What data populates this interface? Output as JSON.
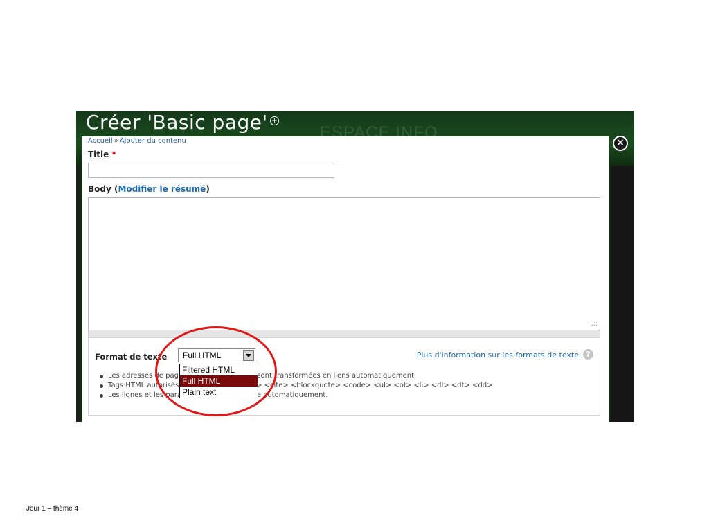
{
  "window": {
    "title": "Créer 'Basic page'",
    "background_brand": "ESPACE INFO"
  },
  "breadcrumb": {
    "home": "Accueil",
    "separator": "»",
    "current": "Ajouter du contenu"
  },
  "form": {
    "title_label": "Title",
    "required_marker": "*",
    "title_value": "",
    "body_label": "Body",
    "body_link": "Modifier le résumé",
    "body_value": ""
  },
  "text_format": {
    "label": "Format de texte",
    "selected": "Full HTML",
    "options": [
      "Filtered HTML",
      "Full HTML",
      "Plain text"
    ],
    "info_link": "Plus d'information sur les formats de texte",
    "tips": [
      "Les adresses de pages web et de courriels sont transformées en liens automatiquement.",
      "Tags HTML autorisés : <a> <em> <strong> <cite> <blockquote> <code> <ul> <ol> <li> <dl> <dt> <dd>",
      "Les lignes et les paragraphes vont à la ligne automatiquement."
    ]
  },
  "footer": {
    "text": "Jour 1 – thème 4"
  },
  "colors": {
    "link": "#1f6bb0",
    "selected_option": "#7a0a0a",
    "highlight_circle": "#e01818",
    "header_dark": "#0f2a10"
  }
}
